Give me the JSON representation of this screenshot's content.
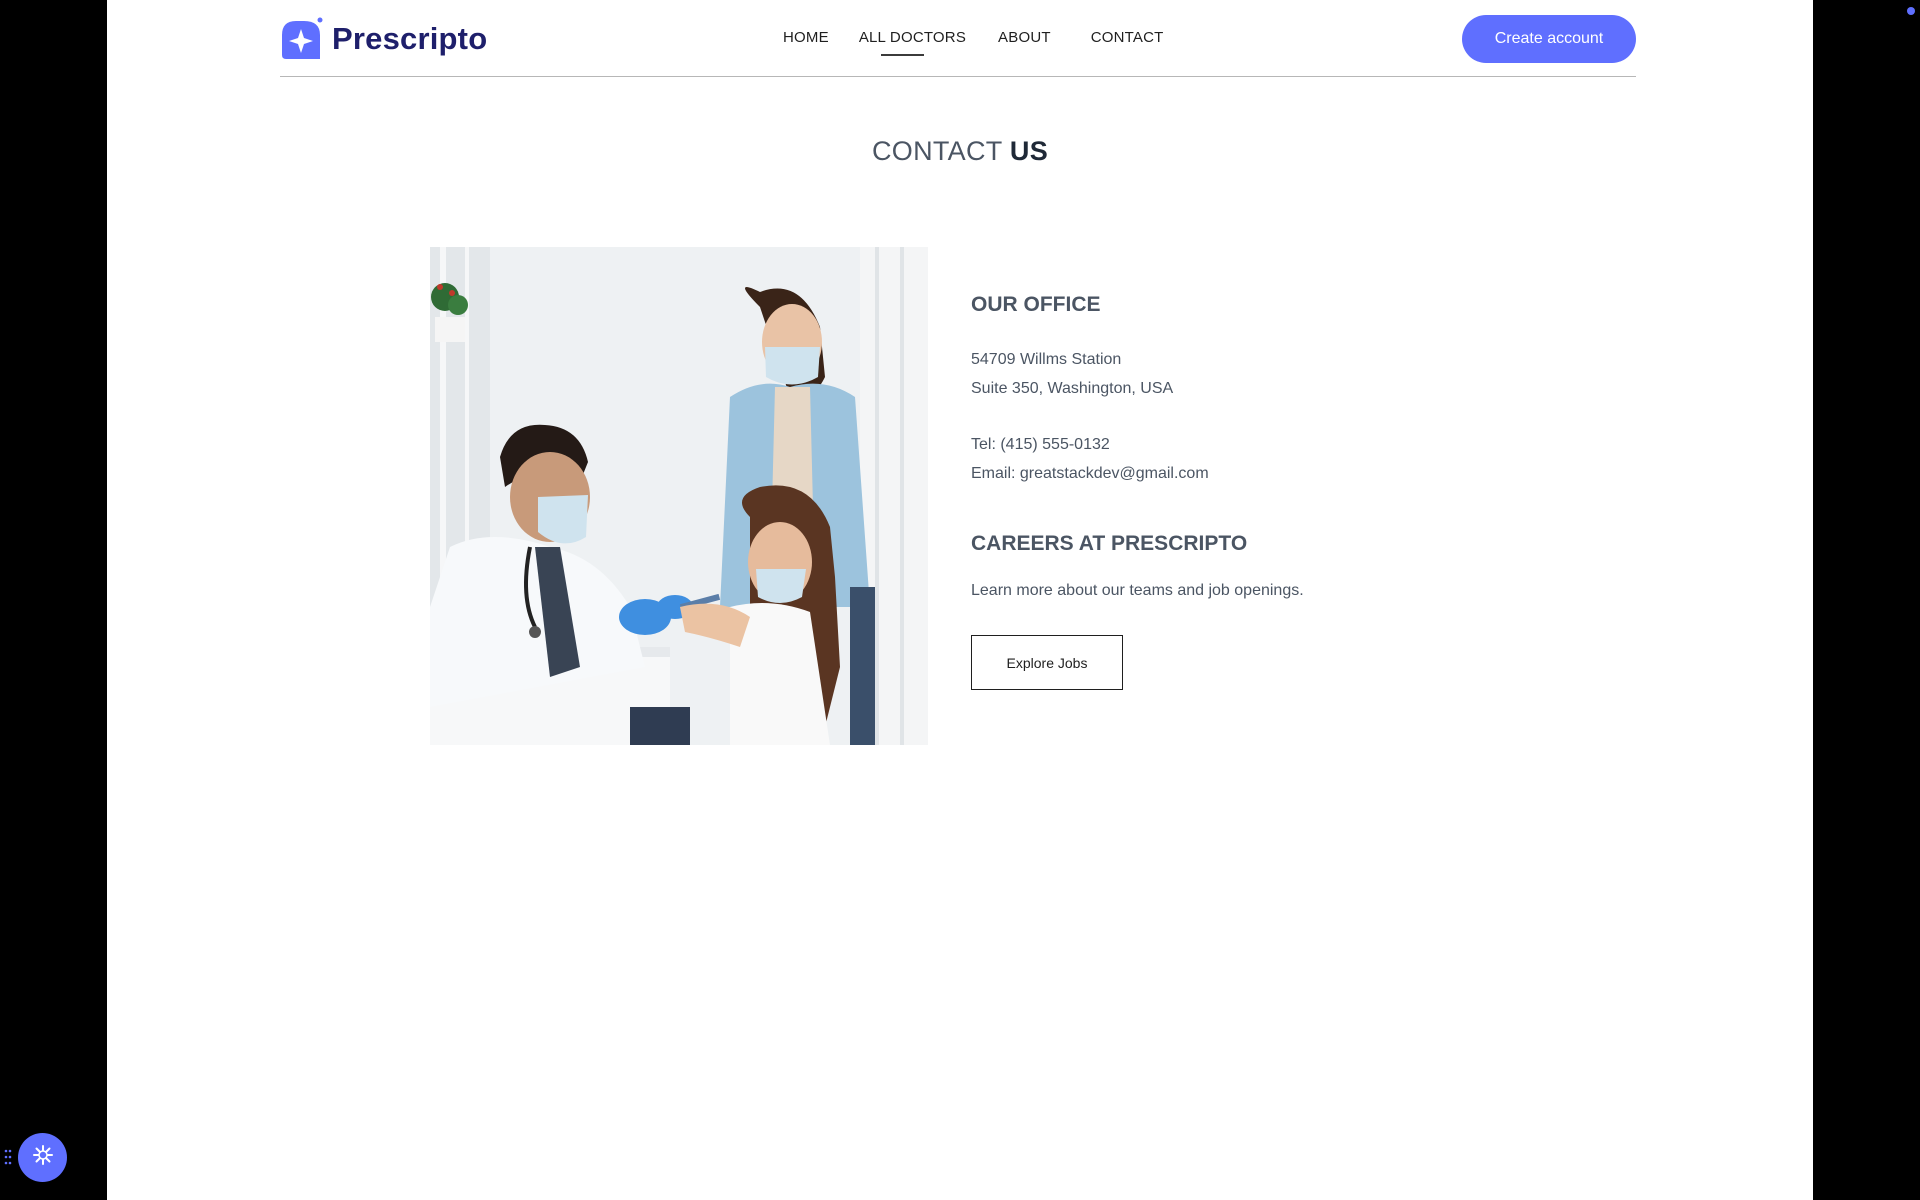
{
  "brand": {
    "name": "Prescripto",
    "accent_color": "#5f6fff",
    "logo_icon": "star-badge-icon"
  },
  "nav": {
    "items": [
      {
        "label": "HOME"
      },
      {
        "label": "ALL DOCTORS",
        "active": true
      },
      {
        "label": "ABOUT"
      },
      {
        "label": "CONTACT"
      }
    ],
    "cta_label": "Create account"
  },
  "heading": {
    "light": "CONTACT",
    "bold": "US"
  },
  "office": {
    "title": "OUR OFFICE",
    "address_line1": "54709 Willms Station",
    "address_line2": "Suite 350, Washington, USA",
    "tel": "Tel: (415) 555-0132",
    "email": "Email: greatstackdev@gmail.com"
  },
  "careers": {
    "title": "CAREERS AT PRESCRIPTO",
    "text": "Learn more about our teams and job openings.",
    "button_label": "Explore Jobs"
  },
  "floating_widget": {
    "icon": "sparkle-icon",
    "handle_icon": "drag-handle-icon"
  }
}
